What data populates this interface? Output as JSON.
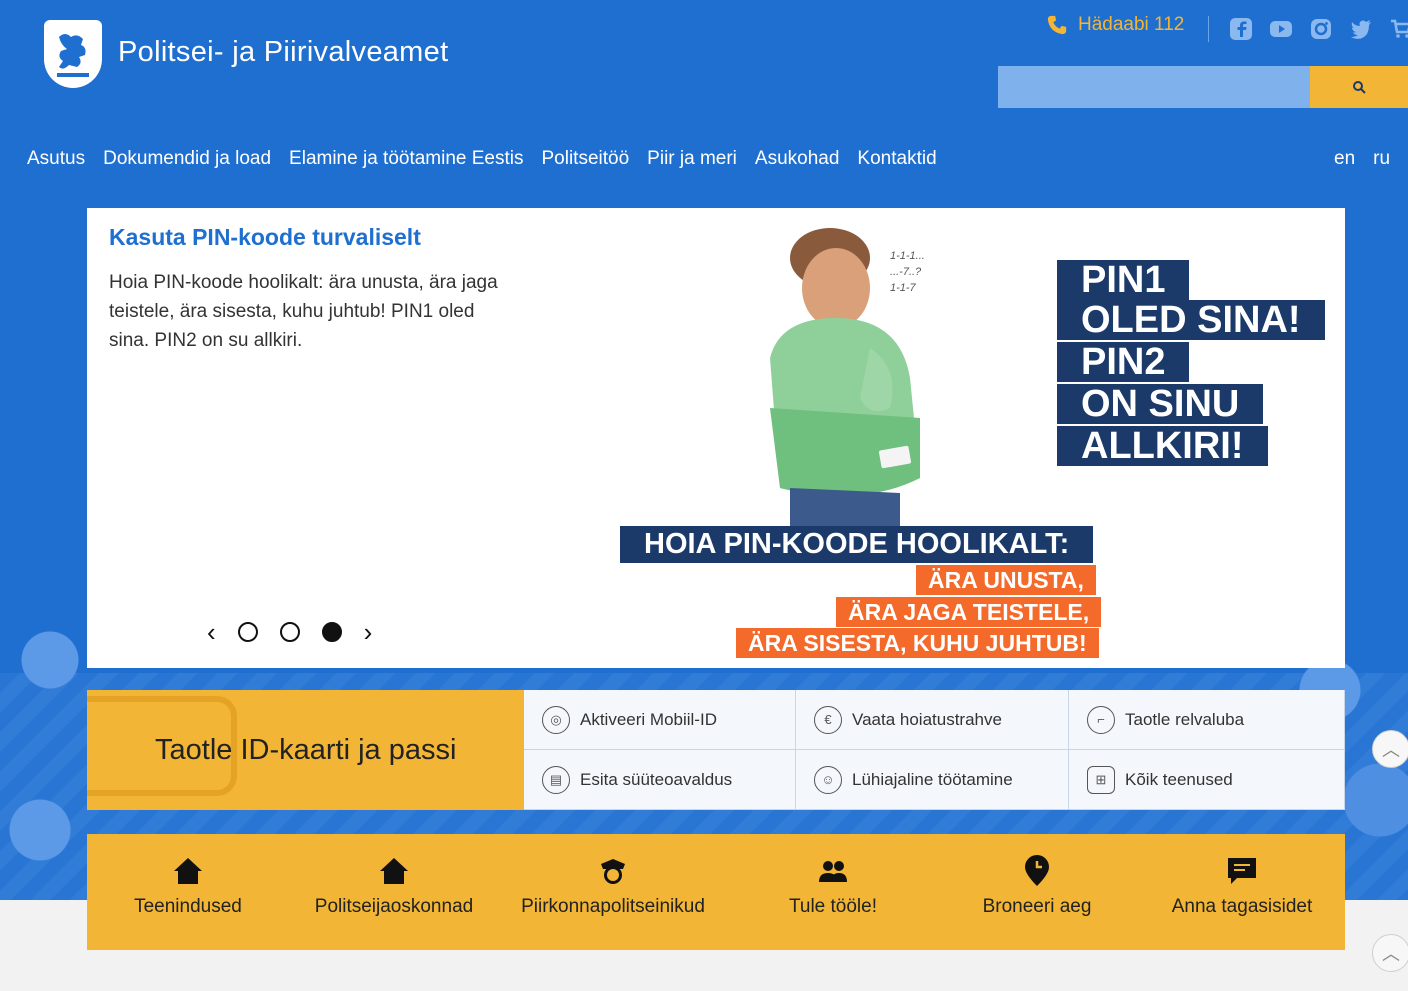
{
  "header": {
    "site_title": "Politsei- ja Piirivalveamet",
    "emergency_label": "Hädaabi 112",
    "social": [
      "facebook-icon",
      "youtube-icon",
      "instagram-icon",
      "twitter-icon",
      "cart-icon"
    ],
    "search": {
      "placeholder": ""
    }
  },
  "nav": {
    "items": [
      "Asutus",
      "Dokumendid ja load",
      "Elamine ja töötamine Eestis",
      "Politseitöö",
      "Piir ja meri",
      "Asukohad",
      "Kontaktid"
    ],
    "languages": [
      "en",
      "ru"
    ]
  },
  "carousel": {
    "title": "Kasuta PIN-koode turvaliselt",
    "text": "Hoia PIN-koode hoolikalt: ära unusta, ära jaga teistele, ära sisesta, kuhu juhtub! PIN1 oled sina. PIN2 on su allkiri.",
    "slide_count": 3,
    "active_slide": 3,
    "image": {
      "pin_lines": [
        "PIN1",
        "OLED SINA!",
        "PIN2",
        "ON SINU",
        "ALLKIRI!"
      ],
      "headline": "HOIA PIN-KOODE HOOLIKALT:",
      "orange_lines": [
        "ÄRA UNUSTA,",
        "ÄRA JAGA TEISTELE,",
        "ÄRA SISESTA, KUHU JUHTUB!"
      ],
      "scribble": [
        "1-1-1...",
        "...-7..?",
        "1-1-7"
      ]
    }
  },
  "services": {
    "featured": "Taotle ID-kaarti ja passi",
    "items": [
      "Aktiveeri Mobiil-ID",
      "Vaata hoiatustrahve",
      "Taotle relvaluba",
      "Esita süüteoavaldus",
      "Lühiajaline töötamine",
      "Kõik teenused"
    ]
  },
  "quick_links": [
    "Teenindused",
    "Politseijaoskonnad",
    "Piirkonnapolitseinikud",
    "Tule tööle!",
    "Broneeri aeg",
    "Anna tagasisidet"
  ],
  "colors": {
    "brand_blue": "#1f6fd0",
    "accent_yellow": "#f2b535",
    "navy": "#1b3a6a",
    "orange": "#f46a2a"
  }
}
